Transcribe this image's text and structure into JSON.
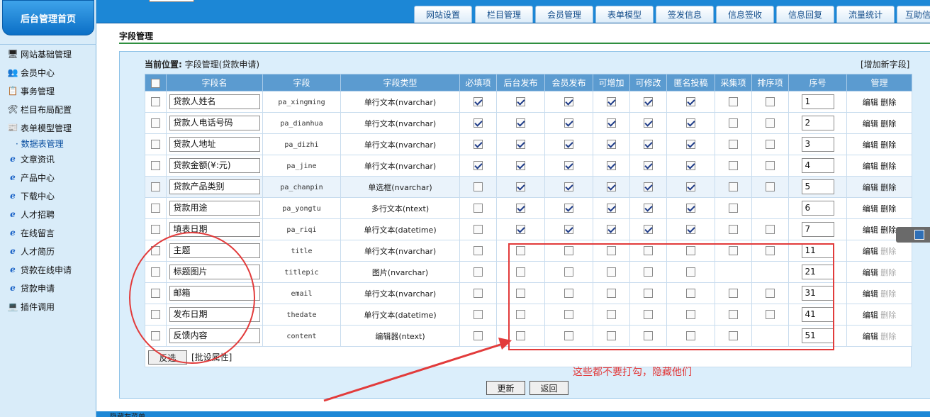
{
  "sidebar": {
    "home": "后台管理首页",
    "items": [
      {
        "label": "网站基础管理",
        "icon": "site-settings-icon"
      },
      {
        "label": "会员中心",
        "icon": "member-icon"
      },
      {
        "label": "事务管理",
        "icon": "task-icon"
      },
      {
        "label": "栏目布局配置",
        "icon": "tools-icon"
      },
      {
        "label": "表单模型管理",
        "icon": "form-model-icon"
      },
      {
        "label": "文章资讯",
        "icon": "ie-icon"
      },
      {
        "label": "产品中心",
        "icon": "ie-icon"
      },
      {
        "label": "下载中心",
        "icon": "ie-icon"
      },
      {
        "label": "人才招聘",
        "icon": "ie-icon"
      },
      {
        "label": "在线留言",
        "icon": "ie-icon"
      },
      {
        "label": "人才简历",
        "icon": "ie-icon"
      },
      {
        "label": "贷款在线申请",
        "icon": "ie-icon"
      },
      {
        "label": "贷款申请",
        "icon": "ie-icon"
      },
      {
        "label": "插件调用",
        "icon": "plugin-icon"
      }
    ],
    "subitem": "· 数据表管理"
  },
  "top_tabs": [
    "网站设置",
    "栏目管理",
    "会员管理",
    "表单模型",
    "签发信息",
    "信息签收",
    "信息回复",
    "流量统计",
    "互助信"
  ],
  "page_title": "字段管理",
  "breadcrumb": {
    "label": "当前位置:",
    "path": "字段管理(贷款申请)"
  },
  "add_field": "[增加新字段]",
  "columns": [
    "字段名",
    "字段",
    "字段类型",
    "必填项",
    "后台发布",
    "会员发布",
    "可增加",
    "可修改",
    "匿名投稿",
    "采集项",
    "排序项",
    "序号",
    "管理"
  ],
  "rows": [
    {
      "name": "贷款人姓名",
      "field": "pa_xingming",
      "type": "单行文本(nvarchar)",
      "checks": [
        1,
        1,
        1,
        1,
        1,
        1,
        0,
        0
      ],
      "order": "1",
      "edit": "编辑",
      "del": "删除",
      "del_dim": false
    },
    {
      "name": "贷款人电话号码",
      "field": "pa_dianhua",
      "type": "单行文本(nvarchar)",
      "checks": [
        1,
        1,
        1,
        1,
        1,
        1,
        0,
        0
      ],
      "order": "2",
      "edit": "编辑",
      "del": "删除",
      "del_dim": false
    },
    {
      "name": "贷款人地址",
      "field": "pa_dizhi",
      "type": "单行文本(nvarchar)",
      "checks": [
        1,
        1,
        1,
        1,
        1,
        1,
        0,
        0
      ],
      "order": "3",
      "edit": "编辑",
      "del": "删除",
      "del_dim": false
    },
    {
      "name": "贷款金额(¥:元)",
      "field": "pa_jine",
      "type": "单行文本(nvarchar)",
      "checks": [
        1,
        1,
        1,
        1,
        1,
        1,
        0,
        0
      ],
      "order": "4",
      "edit": "编辑",
      "del": "删除",
      "del_dim": false
    },
    {
      "name": "贷款产品类别",
      "field": "pa_chanpin",
      "type": "单选框(nvarchar)",
      "checks": [
        0,
        1,
        1,
        1,
        1,
        1,
        0,
        0
      ],
      "order": "5",
      "edit": "编辑",
      "del": "删除",
      "del_dim": false
    },
    {
      "name": "贷款用途",
      "field": "pa_yongtu",
      "type": "多行文本(ntext)",
      "checks": [
        0,
        1,
        1,
        1,
        1,
        1,
        0,
        -1
      ],
      "order": "6",
      "edit": "编辑",
      "del": "删除",
      "del_dim": false
    },
    {
      "name": "填表日期",
      "field": "pa_riqi",
      "type": "单行文本(datetime)",
      "checks": [
        0,
        1,
        1,
        1,
        1,
        1,
        0,
        0
      ],
      "order": "7",
      "edit": "编辑",
      "del": "删除",
      "del_dim": false
    },
    {
      "name": "主题",
      "field": "title",
      "type": "单行文本(nvarchar)",
      "checks": [
        0,
        0,
        0,
        0,
        0,
        0,
        0,
        0
      ],
      "order": "11",
      "edit": "编辑",
      "del": "删除",
      "del_dim": true
    },
    {
      "name": "标题图片",
      "field": "titlepic",
      "type": "图片(nvarchar)",
      "checks": [
        0,
        0,
        0,
        0,
        0,
        0,
        -1,
        -1
      ],
      "order": "21",
      "edit": "编辑",
      "del": "删除",
      "del_dim": true
    },
    {
      "name": "邮箱",
      "field": "email",
      "type": "单行文本(nvarchar)",
      "checks": [
        0,
        0,
        0,
        0,
        0,
        0,
        0,
        0
      ],
      "order": "31",
      "edit": "编辑",
      "del": "删除",
      "del_dim": true
    },
    {
      "name": "发布日期",
      "field": "thedate",
      "type": "单行文本(datetime)",
      "checks": [
        0,
        0,
        0,
        0,
        0,
        0,
        0,
        0
      ],
      "order": "41",
      "edit": "编辑",
      "del": "删除",
      "del_dim": true
    },
    {
      "name": "反馈内容",
      "field": "content",
      "type": "编辑器(ntext)",
      "checks": [
        0,
        0,
        0,
        0,
        0,
        0,
        0,
        -1
      ],
      "order": "51",
      "edit": "编辑",
      "del": "删除",
      "del_dim": true
    }
  ],
  "buttons": {
    "invert": "反选",
    "batch": "[批设属性]",
    "update": "更新",
    "back": "返回"
  },
  "annotation": "这些都不要打勾，隐藏他们",
  "bottom_text": "隐藏左菜单",
  "colors": {
    "accent": "#1c87d6",
    "annotation": "#e23b3b",
    "header": "#5b9bd0"
  }
}
